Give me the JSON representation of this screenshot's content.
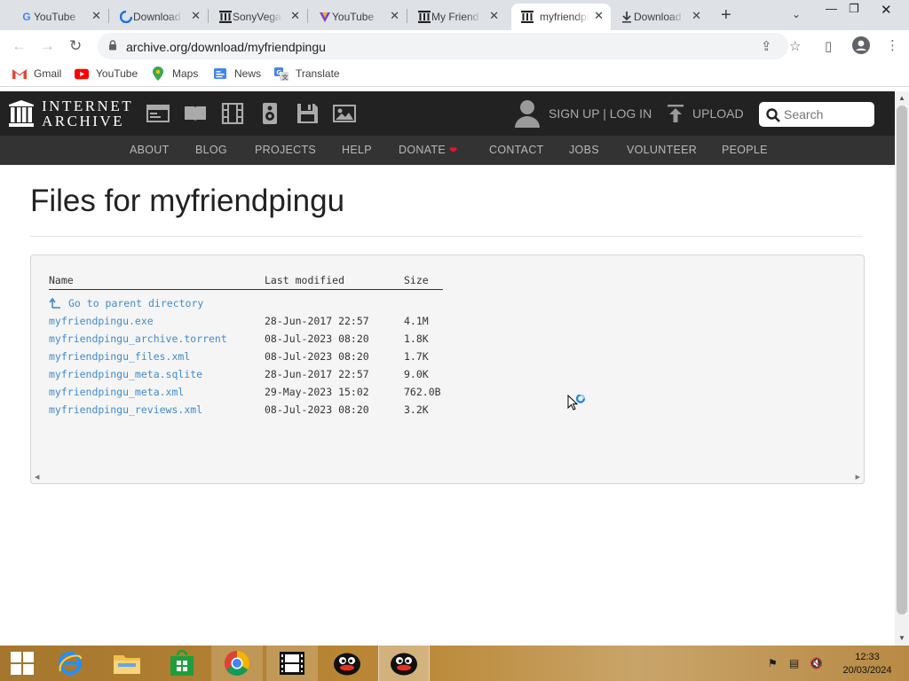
{
  "browser": {
    "tabs": [
      {
        "title": "YouTube",
        "favicon": "google-g-icon",
        "active": false
      },
      {
        "title": "Download",
        "favicon": "blue-swirl-icon",
        "active": false
      },
      {
        "title": "SonyVegas",
        "favicon": "internet-archive-icon",
        "active": false
      },
      {
        "title": "YouTube",
        "favicon": "vegas-v-icon",
        "active": false
      },
      {
        "title": "My Friend",
        "favicon": "internet-archive-icon",
        "active": false
      },
      {
        "title": "myfriendpingu",
        "favicon": "internet-archive-icon",
        "active": true
      },
      {
        "title": "Download",
        "favicon": "download-arrow-icon",
        "active": false
      }
    ],
    "url": "archive.org/download/myfriendpingu",
    "bookmarks": [
      {
        "label": "Gmail",
        "icon": "gmail-icon"
      },
      {
        "label": "YouTube",
        "icon": "youtube-icon"
      },
      {
        "label": "Maps",
        "icon": "maps-icon"
      },
      {
        "label": "News",
        "icon": "news-icon"
      },
      {
        "label": "Translate",
        "icon": "translate-icon"
      }
    ]
  },
  "ia": {
    "logo_line1": "INTERNET",
    "logo_line2": "ARCHIVE",
    "signup": "SIGN UP | LOG IN",
    "upload": "UPLOAD",
    "search_placeholder": "Search",
    "nav": [
      "ABOUT",
      "BLOG",
      "PROJECTS",
      "HELP",
      "DONATE",
      "CONTACT",
      "JOBS",
      "VOLUNTEER",
      "PEOPLE"
    ]
  },
  "page": {
    "title": "Files for myfriendpingu",
    "columns": {
      "name": "Name",
      "modified": "Last modified",
      "size": "Size"
    },
    "parent_link": "Go to parent directory",
    "files": [
      {
        "name": "myfriendpingu.exe",
        "modified": "28-Jun-2017 22:57",
        "size": "4.1M"
      },
      {
        "name": "myfriendpingu_archive.torrent",
        "modified": "08-Jul-2023 08:20",
        "size": "1.8K"
      },
      {
        "name": "myfriendpingu_files.xml",
        "modified": "08-Jul-2023 08:20",
        "size": "1.7K"
      },
      {
        "name": "myfriendpingu_meta.sqlite",
        "modified": "28-Jun-2017 22:57",
        "size": "9.0K"
      },
      {
        "name": "myfriendpingu_meta.xml",
        "modified": "29-May-2023 15:02",
        "size": "762.0B"
      },
      {
        "name": "myfriendpingu_reviews.xml",
        "modified": "08-Jul-2023 08:20",
        "size": "3.2K"
      }
    ]
  },
  "taskbar": {
    "apps": [
      "start-button",
      "internet-explorer-icon",
      "file-explorer-icon",
      "store-icon",
      "chrome-icon",
      "film-icon",
      "pingu-icon",
      "pingu-icon"
    ],
    "time": "12:33",
    "date": "20/03/2024"
  },
  "colors": {
    "ia_header": "#222222",
    "ia_nav": "#333333",
    "link": "#428bca",
    "heart": "#e0162b"
  }
}
